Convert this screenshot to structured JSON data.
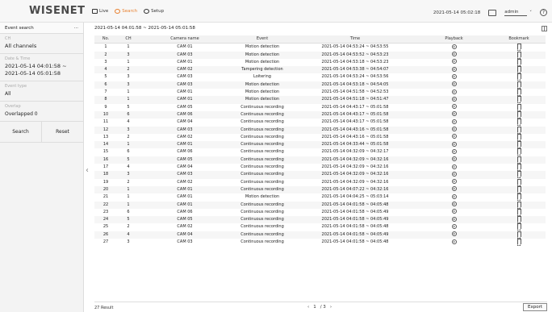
{
  "header": {
    "logo": "WISENET",
    "nav": [
      {
        "label": "Live",
        "icon": "monitor-icon"
      },
      {
        "label": "Search",
        "icon": "search-icon"
      },
      {
        "label": "Setup",
        "icon": "gear-icon"
      }
    ],
    "datetime": "2021-05-14 05:02:18",
    "user": "admin"
  },
  "sidebar": {
    "title": "Event search",
    "menu_glyph": "···",
    "fields": [
      {
        "label": "CH",
        "value": "All channels"
      },
      {
        "label": "Date & Time",
        "value": "2021-05-14 04:01:58 ~\n2021-05-14 05:01:58"
      },
      {
        "label": "Event type",
        "value": "All"
      },
      {
        "label": "Overlap",
        "value": "Overlapped 0"
      }
    ],
    "search_label": "Search",
    "reset_label": "Reset"
  },
  "main": {
    "range": "2021-05-14 04:01:58 ~ 2021-05-14 05:01:58",
    "columns": [
      "No.",
      "CH",
      "Camera name",
      "Event",
      "Time",
      "Playback",
      "Bookmark"
    ],
    "rows": [
      [
        "1",
        "1",
        "CAM 01",
        "Motion detection",
        "2021-05-14 04:53:24 ~ 04:53:55"
      ],
      [
        "2",
        "3",
        "CAM 03",
        "Motion detection",
        "2021-05-14 04:53:52 ~ 04:53:23"
      ],
      [
        "3",
        "1",
        "CAM 01",
        "Motion detection",
        "2021-05-14 04:53:18 ~ 04:53:23"
      ],
      [
        "4",
        "2",
        "CAM 02",
        "Tampering detection",
        "2021-05-14 04:53:38 ~ 04:54:07"
      ],
      [
        "5",
        "3",
        "CAM 03",
        "Loitering",
        "2021-05-14 04:53:24 ~ 04:53:56"
      ],
      [
        "6",
        "3",
        "CAM 03",
        "Motion detection",
        "2021-05-14 04:53:18 ~ 04:54:05"
      ],
      [
        "7",
        "1",
        "CAM 01",
        "Motion detection",
        "2021-05-14 04:51:58 ~ 04:52:53"
      ],
      [
        "8",
        "1",
        "CAM 01",
        "Motion detection",
        "2021-05-14 04:51:18 ~ 04:51:47"
      ],
      [
        "9",
        "5",
        "CAM 05",
        "Continuous recording",
        "2021-05-14 04:43:17 ~ 05:01:58"
      ],
      [
        "10",
        "6",
        "CAM 06",
        "Continuous recording",
        "2021-05-14 04:43:17 ~ 05:01:58"
      ],
      [
        "11",
        "4",
        "CAM 04",
        "Continuous recording",
        "2021-05-14 04:43:17 ~ 05:01:58"
      ],
      [
        "12",
        "3",
        "CAM 03",
        "Continuous recording",
        "2021-05-14 04:43:16 ~ 05:01:58"
      ],
      [
        "13",
        "2",
        "CAM 02",
        "Continuous recording",
        "2021-05-14 04:43:16 ~ 05:01:58"
      ],
      [
        "14",
        "1",
        "CAM 01",
        "Continuous recording",
        "2021-05-14 04:33:44 ~ 05:01:58"
      ],
      [
        "15",
        "6",
        "CAM 06",
        "Continuous recording",
        "2021-05-14 04:32:09 ~ 04:32:17"
      ],
      [
        "16",
        "5",
        "CAM 05",
        "Continuous recording",
        "2021-05-14 04:32:09 ~ 04:32:16"
      ],
      [
        "17",
        "4",
        "CAM 04",
        "Continuous recording",
        "2021-05-14 04:32:09 ~ 04:32:16"
      ],
      [
        "18",
        "3",
        "CAM 03",
        "Continuous recording",
        "2021-05-14 04:32:09 ~ 04:32:16"
      ],
      [
        "19",
        "2",
        "CAM 02",
        "Continuous recording",
        "2021-05-14 04:32:09 ~ 04:32:16"
      ],
      [
        "20",
        "1",
        "CAM 01",
        "Continuous recording",
        "2021-05-14 04:07:22 ~ 04:32:16"
      ],
      [
        "21",
        "1",
        "CAM 01",
        "Motion detection",
        "2021-05-14 04:04:25 ~ 05:03:14"
      ],
      [
        "22",
        "1",
        "CAM 01",
        "Continuous recording",
        "2021-05-14 04:01:58 ~ 04:05:48"
      ],
      [
        "23",
        "6",
        "CAM 06",
        "Continuous recording",
        "2021-05-14 04:01:58 ~ 04:05:49"
      ],
      [
        "24",
        "5",
        "CAM 05",
        "Continuous recording",
        "2021-05-14 04:01:58 ~ 04:05:49"
      ],
      [
        "25",
        "2",
        "CAM 02",
        "Continuous recording",
        "2021-05-14 04:01:58 ~ 04:05:48"
      ],
      [
        "26",
        "4",
        "CAM 04",
        "Continuous recording",
        "2021-05-14 04:01:58 ~ 04:05:49"
      ],
      [
        "27",
        "3",
        "CAM 03",
        "Continuous recording",
        "2021-05-14 04:01:58 ~ 04:05:48"
      ]
    ],
    "result": "27 Result",
    "pager": {
      "prev": "‹",
      "current": "1",
      "total": "/ 3",
      "next": "›"
    },
    "export_label": "Export"
  },
  "colors": {
    "accent": "#e88030"
  }
}
